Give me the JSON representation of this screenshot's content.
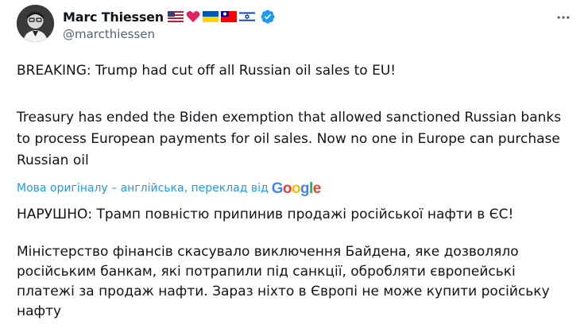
{
  "author": {
    "display_name": "Marc Thiessen",
    "handle": "@marcthiessen",
    "flags": [
      "us-flag-icon",
      "heart-icon",
      "ukraine-flag-icon",
      "taiwan-flag-icon",
      "israel-flag-icon"
    ],
    "verified_color": "#1d9bf0"
  },
  "tweet": {
    "original_paragraphs": [
      "BREAKING: Trump had cut off all Russian oil sales to EU!",
      "Treasury has ended the Biden exemption that allowed sanctioned Russian banks to process European payments for oil sales. Now no one in Europe can purchase Russian oil"
    ],
    "translation_note": "Мова оригіналу – англійська, переклад від",
    "translation_provider": "Google",
    "translated_paragraphs": [
      "НАРУШНО: Трамп повністю припинив продажі російської нафти в ЄС!",
      "Міністерство фінансів скасувало виключення Байдена, яке дозволяло російським банкам, які потрапили під санкції, обробляти європейські платежі за продаж нафти. Зараз ніхто в Європі не може купити російську нафту"
    ]
  },
  "colors": {
    "text": "#0f1419",
    "secondary": "#536471",
    "link": "#1d9bf0"
  }
}
